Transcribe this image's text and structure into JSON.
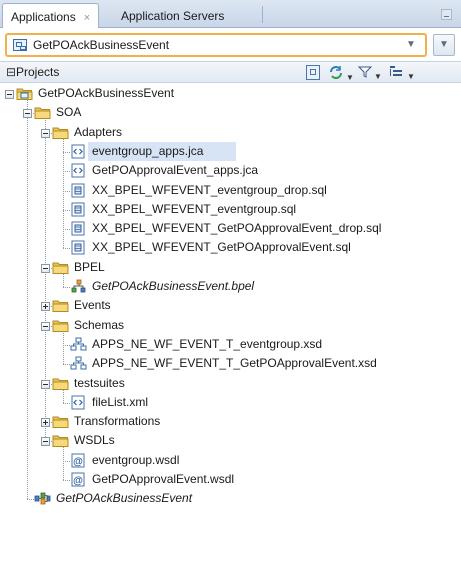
{
  "tabs": {
    "applications": "Applications",
    "close_glyph": "×",
    "application_servers": "Application Servers"
  },
  "app_selector": {
    "value": "GetPOAckBusinessEvent",
    "icon": "application-icon"
  },
  "projects": {
    "title": "Projects",
    "toolbar": [
      "sync-editor-icon",
      "refresh-icon",
      "filter-icon",
      "layout-options-icon"
    ]
  },
  "tree": [
    {
      "label": "GetPOAckBusinessEvent",
      "level": 0,
      "icon": "project-folder-icon",
      "toggle": "minus"
    },
    {
      "label": "SOA",
      "level": 1,
      "icon": "folder-icon",
      "toggle": "minus"
    },
    {
      "label": "Adapters",
      "level": 2,
      "icon": "folder-icon",
      "toggle": "minus"
    },
    {
      "label": "eventgroup_apps.jca",
      "level": 3,
      "icon": "jca-file-icon",
      "toggle": "",
      "selected": true
    },
    {
      "label": "GetPOApprovalEvent_apps.jca",
      "level": 3,
      "icon": "jca-file-icon",
      "toggle": ""
    },
    {
      "label": "XX_BPEL_WFEVENT_eventgroup_drop.sql",
      "level": 3,
      "icon": "sql-file-icon",
      "toggle": ""
    },
    {
      "label": "XX_BPEL_WFEVENT_eventgroup.sql",
      "level": 3,
      "icon": "sql-file-icon",
      "toggle": ""
    },
    {
      "label": "XX_BPEL_WFEVENT_GetPOApprovalEvent_drop.sql",
      "level": 3,
      "icon": "sql-file-icon",
      "toggle": ""
    },
    {
      "label": "XX_BPEL_WFEVENT_GetPOApprovalEvent.sql",
      "level": 3,
      "icon": "sql-file-icon",
      "toggle": ""
    },
    {
      "label": "BPEL",
      "level": 2,
      "icon": "folder-icon",
      "toggle": "minus"
    },
    {
      "label": "GetPOAckBusinessEvent.bpel",
      "level": 3,
      "icon": "bpel-process-icon",
      "toggle": "",
      "italic": true
    },
    {
      "label": "Events",
      "level": 2,
      "icon": "folder-icon",
      "toggle": "plus"
    },
    {
      "label": "Schemas",
      "level": 2,
      "icon": "folder-icon",
      "toggle": "minus"
    },
    {
      "label": "APPS_NE_WF_EVENT_T_eventgroup.xsd",
      "level": 3,
      "icon": "xsd-schema-icon",
      "toggle": ""
    },
    {
      "label": "APPS_NE_WF_EVENT_T_GetPOApprovalEvent.xsd",
      "level": 3,
      "icon": "xsd-schema-icon",
      "toggle": ""
    },
    {
      "label": "testsuites",
      "level": 2,
      "icon": "folder-icon",
      "toggle": "minus"
    },
    {
      "label": "fileList.xml",
      "level": 3,
      "icon": "xml-file-icon",
      "toggle": ""
    },
    {
      "label": "Transformations",
      "level": 2,
      "icon": "folder-icon",
      "toggle": "plus"
    },
    {
      "label": "WSDLs",
      "level": 2,
      "icon": "folder-icon",
      "toggle": "minus"
    },
    {
      "label": "eventgroup.wsdl",
      "level": 3,
      "icon": "wsdl-file-icon",
      "toggle": ""
    },
    {
      "label": "GetPOApprovalEvent.wsdl",
      "level": 3,
      "icon": "wsdl-file-icon",
      "toggle": ""
    },
    {
      "label": "GetPOAckBusinessEvent",
      "level": 1,
      "icon": "composite-icon",
      "toggle": "",
      "italic": true
    }
  ],
  "colors": {
    "selection": "#d7e4f5",
    "folder": "#e8c45a",
    "combo_border": "#f2b04c",
    "tab_bar": "#c9d6e8"
  }
}
